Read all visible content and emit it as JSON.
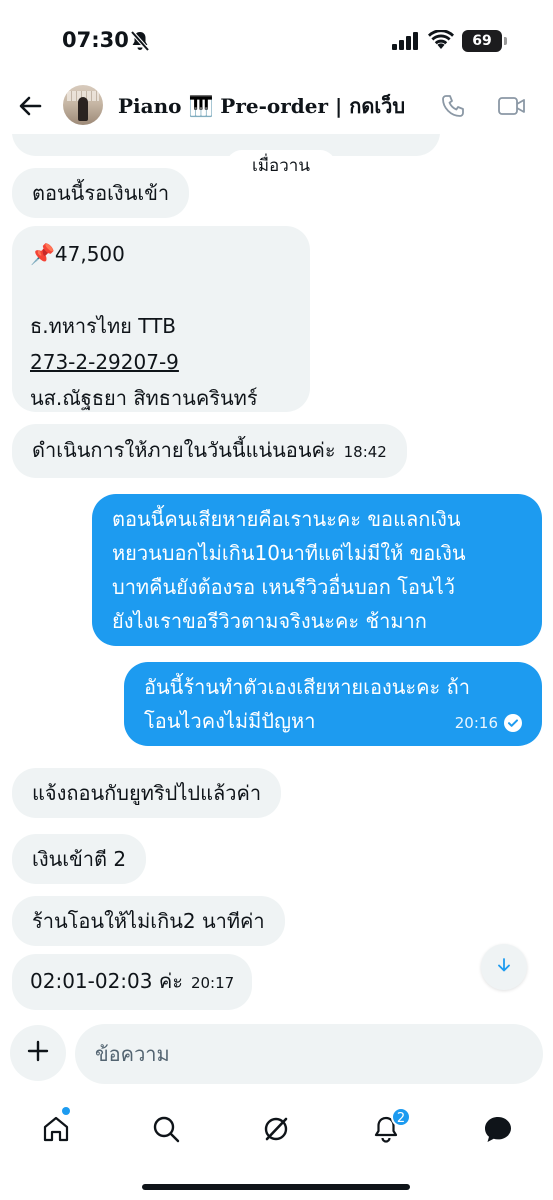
{
  "status_bar": {
    "time": "07:30",
    "battery": "69"
  },
  "header": {
    "title": "Piano 🎹 Pre-order | กดเว็บ"
  },
  "chat": {
    "day_separator": "เมื่อวาน",
    "messages": [
      {
        "dir": "in",
        "text": "ตอนนี้รอเงินเข้า"
      },
      {
        "dir": "in",
        "line1": "📌47,500",
        "line2": "ธ.ทหารไทย TTB",
        "account": "273-2-29207-9",
        "line4": "นส.ณัฐธยา สิทธานครินทร์"
      },
      {
        "dir": "in",
        "text": "ดำเนินการให้ภายในวันนี้แน่นอนค่ะ",
        "time": "18:42"
      },
      {
        "dir": "out",
        "lines": [
          "ตอนนี้คนเสียหายคือเรานะคะ ขอแลกเงิน",
          "หยวนบอกไม่เกิน10นาทีแต่ไม่มีให้ ขอเงิน",
          "บาทคืนยังต้องรอ เหนรีวิวอื่นบอก โอนไว้",
          "ยังไงเราขอรีวิวตามจริงนะคะ ช้ามาก"
        ]
      },
      {
        "dir": "out",
        "lines": [
          "อันนี้ร้านทำตัวเองเสียหายเองนะคะ ถ้า",
          "โอนไวคงไม่มีปัญหา"
        ],
        "time": "20:16"
      },
      {
        "dir": "in",
        "text": "แจ้งถอนกับยูทริปไปแล้วค่า"
      },
      {
        "dir": "in",
        "text": "เงินเข้าตี 2"
      },
      {
        "dir": "in",
        "text": "ร้านโอนให้ไม่เกิน2 นาทีค่า"
      },
      {
        "dir": "in",
        "text": "02:01-02:03 ค่ะ",
        "time": "20:17"
      }
    ]
  },
  "composer": {
    "placeholder": "ข้อความ"
  },
  "nav": {
    "notifications_badge": "2"
  },
  "colors": {
    "accent": "#1d9bf0",
    "incoming_bubble": "#eff3f4",
    "text": "#0f1419"
  }
}
